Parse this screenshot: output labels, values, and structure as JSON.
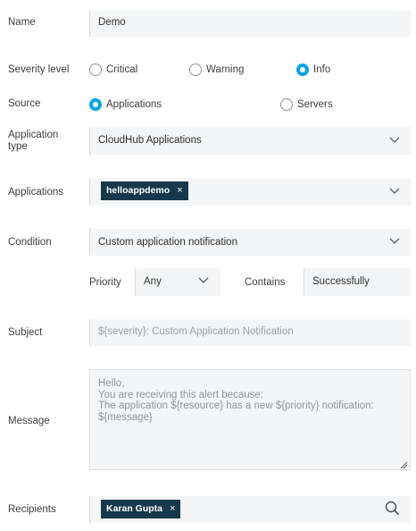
{
  "form": {
    "name": {
      "label": "Name",
      "value": "Demo"
    },
    "severity": {
      "label": "Severity level",
      "options": [
        "Critical",
        "Warning",
        "Info"
      ],
      "selected": "Info"
    },
    "source": {
      "label": "Source",
      "options": [
        "Applications",
        "Servers"
      ],
      "selected": "Applications"
    },
    "application_type": {
      "label_line1": "Application",
      "label_line2": "type",
      "value": "CloudHub Applications"
    },
    "applications": {
      "label": "Applications",
      "chips": [
        "helloappdemo"
      ],
      "chip_remove": "×"
    },
    "condition": {
      "label": "Condition",
      "value": "Custom application notification"
    },
    "priority": {
      "label": "Priority",
      "value": "Any"
    },
    "contains": {
      "label": "Contains",
      "value": "Successfully"
    },
    "subject": {
      "label": "Subject",
      "placeholder": "${severity}: Custom Application Notification"
    },
    "message": {
      "label": "Message",
      "placeholder": "Hello,\nYou are receiving this alert because:\nThe application ${resource} has a new ${priority} notification:\n${message}"
    },
    "recipients": {
      "label": "Recipients",
      "chips": [
        "Karan Gupta"
      ],
      "chip_remove": "×"
    }
  },
  "colors": {
    "accent": "#0aa4e6",
    "chip_bg": "#16384a",
    "field_bg": "#f4f5f6"
  },
  "icons": {
    "dropdown": "chevron-down-icon",
    "search": "search-icon",
    "resize": "resize-grip-icon"
  }
}
